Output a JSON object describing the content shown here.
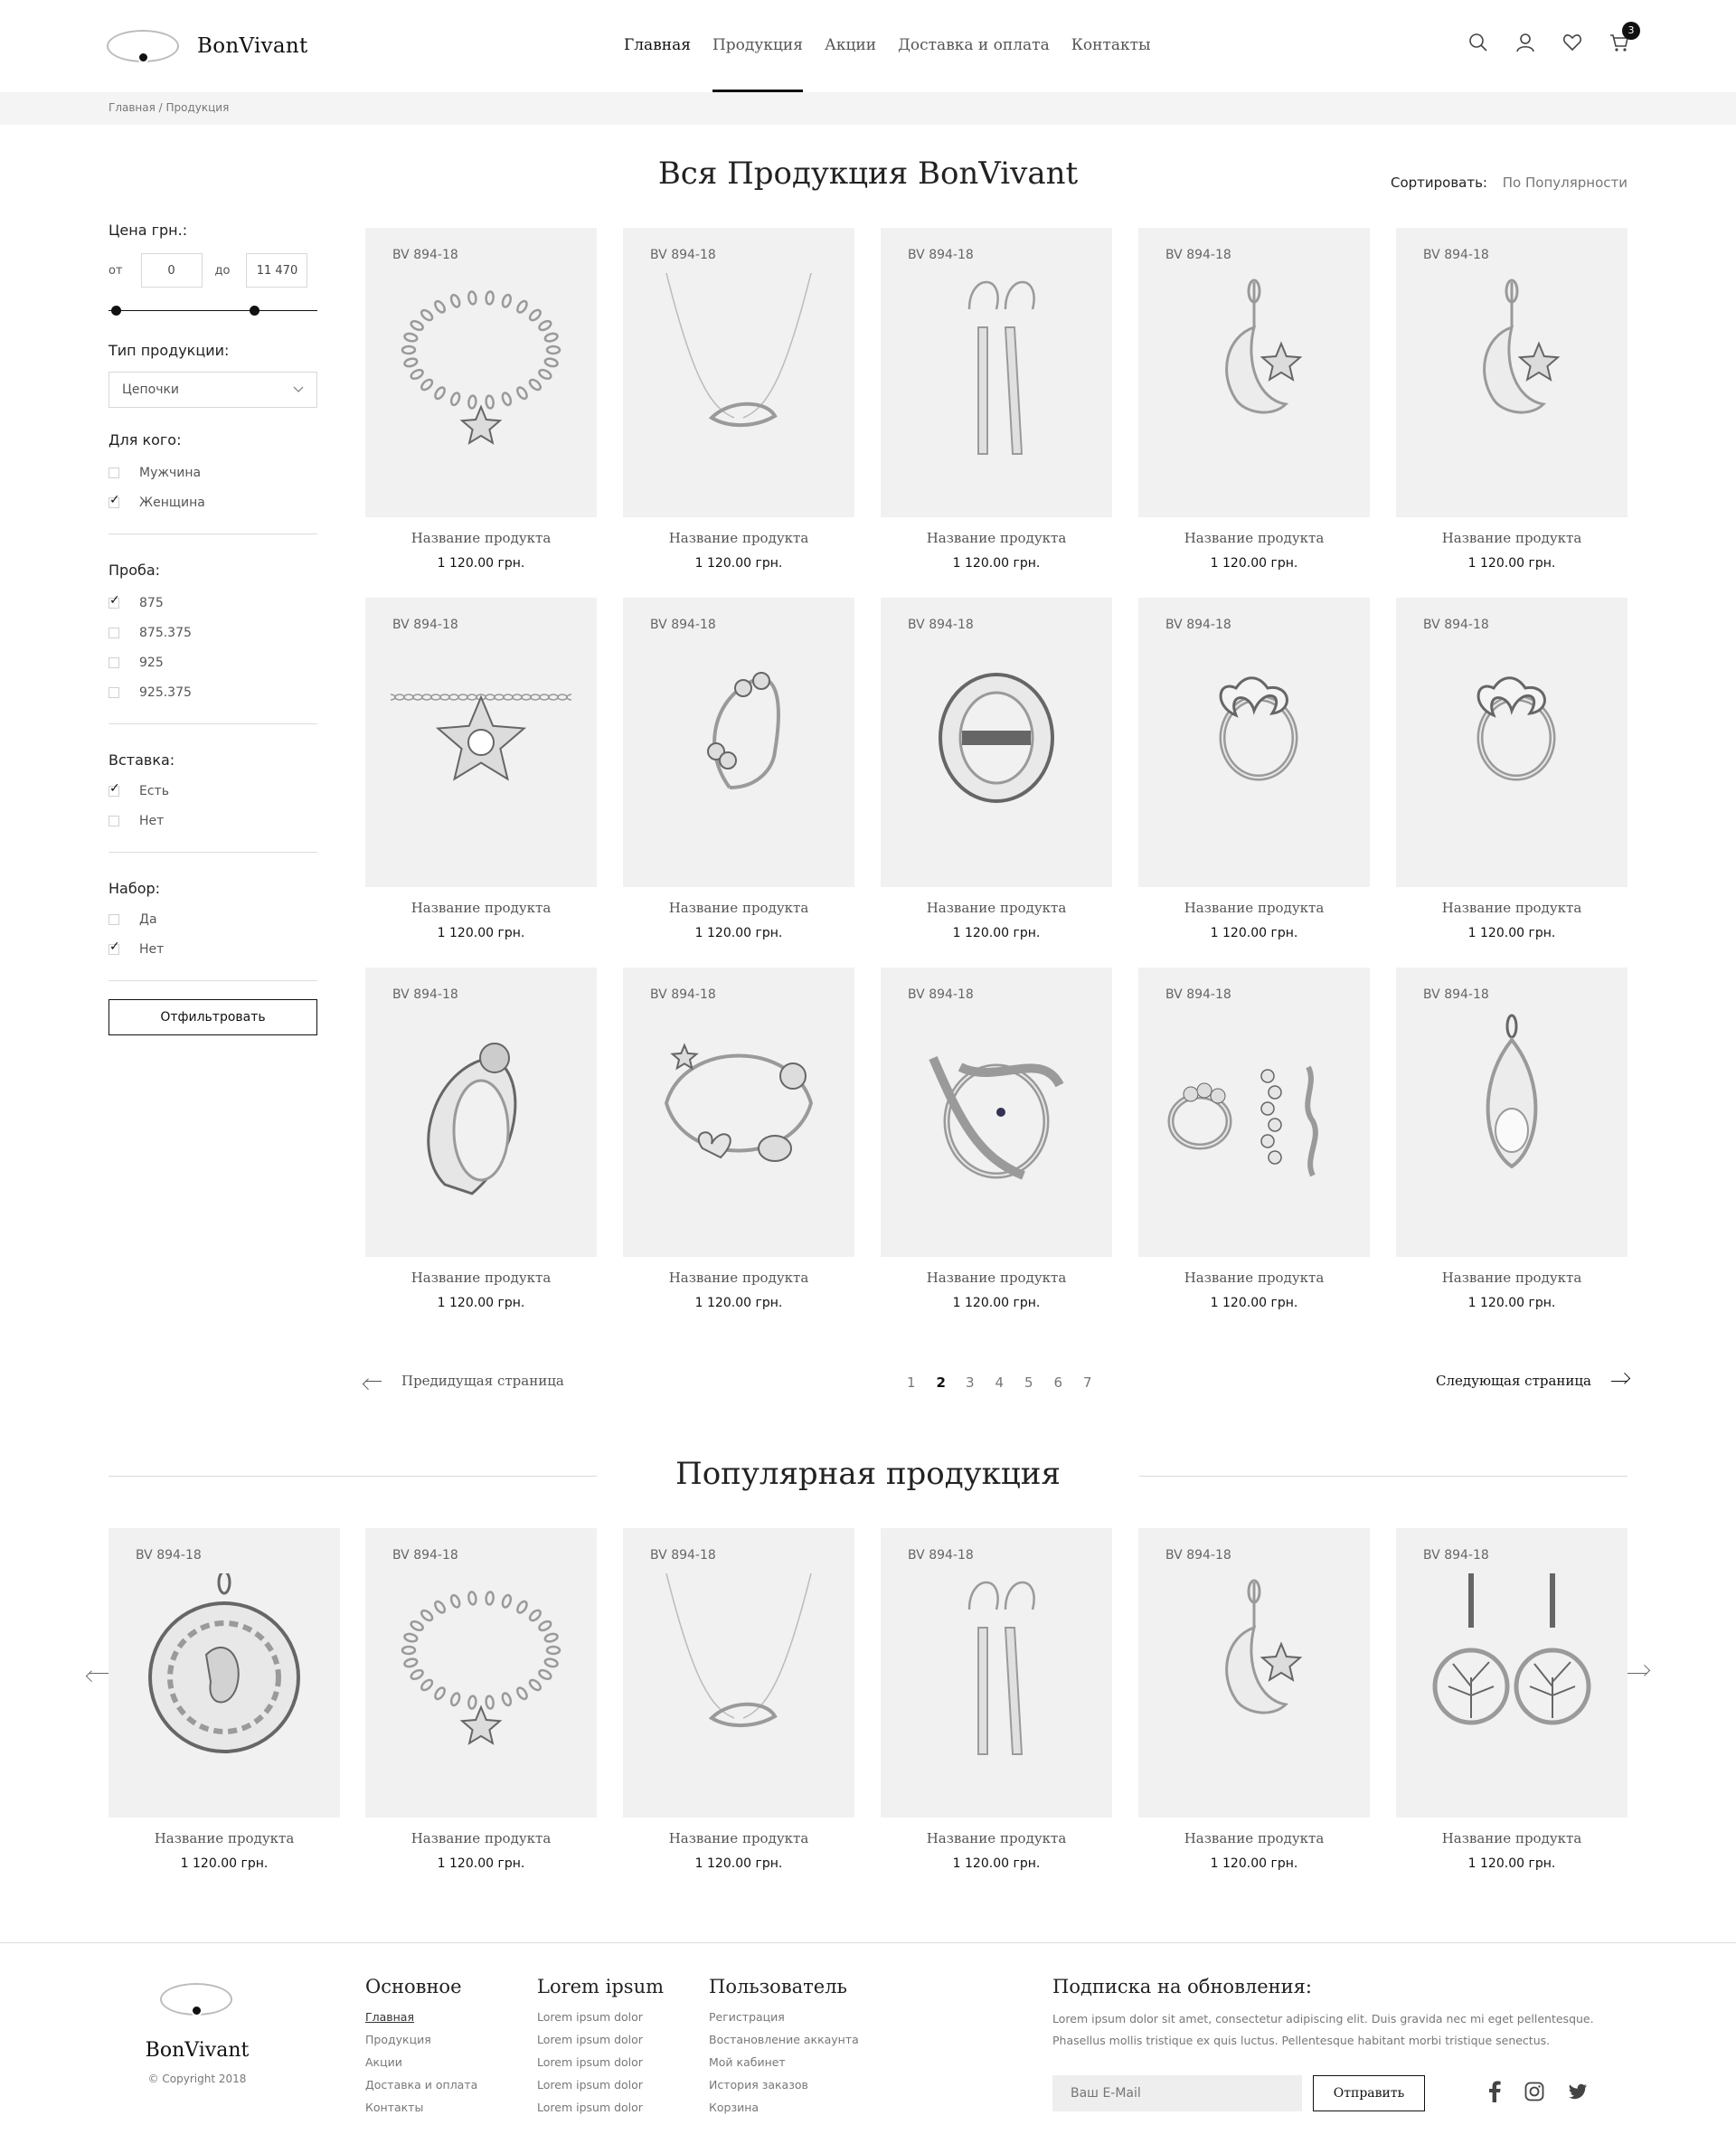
{
  "header": {
    "brand": "BonVivant",
    "nav": [
      "Главная",
      "Продукция",
      "Акции",
      "Доставка и оплата",
      "Контакты"
    ],
    "active_nav": "Продукция",
    "cart_count": "3",
    "icons": [
      "search-icon",
      "user-icon",
      "heart-icon",
      "cart-icon"
    ]
  },
  "breadcrumb": "Главная / Продукция",
  "page_title": "Вся Продукция BonVivant",
  "sort": {
    "label": "Сортировать:",
    "value": "По Популярности"
  },
  "filters": {
    "price": {
      "title": "Цена грн.:",
      "from_label": "от",
      "from_value": "0",
      "to_label": "до",
      "to_value": "11 470"
    },
    "type": {
      "title": "Тип продукции:",
      "selected": "Цепочки"
    },
    "for_whom": {
      "title": "Для кого:",
      "options": [
        {
          "label": "Мужчина",
          "checked": false
        },
        {
          "label": "Женщина",
          "checked": true
        }
      ]
    },
    "proba": {
      "title": "Проба:",
      "options": [
        {
          "label": "875",
          "checked": true
        },
        {
          "label": "875.375",
          "checked": false
        },
        {
          "label": "925",
          "checked": false
        },
        {
          "label": "925.375",
          "checked": false
        }
      ]
    },
    "insert": {
      "title": "Вставка:",
      "options": [
        {
          "label": "Есть",
          "checked": true
        },
        {
          "label": "Нет",
          "checked": false
        }
      ]
    },
    "set": {
      "title": "Набор:",
      "options": [
        {
          "label": "Да",
          "checked": false
        },
        {
          "label": "Нет",
          "checked": true
        }
      ]
    },
    "button": "Отфильтровать"
  },
  "products": [
    {
      "sku": "BV 894-18",
      "name": "Название продукта",
      "price": "1 120.00 грн.",
      "kind": "bracelet"
    },
    {
      "sku": "BV 894-18",
      "name": "Название продукта",
      "price": "1 120.00 грн.",
      "kind": "necklace"
    },
    {
      "sku": "BV 894-18",
      "name": "Название продукта",
      "price": "1 120.00 грн.",
      "kind": "earrings"
    },
    {
      "sku": "BV 894-18",
      "name": "Название продукта",
      "price": "1 120.00 грн.",
      "kind": "moon-pendant"
    },
    {
      "sku": "BV 894-18",
      "name": "Название продукта",
      "price": "1 120.00 грн.",
      "kind": "moon-pendant"
    },
    {
      "sku": "BV 894-18",
      "name": "Название продукта",
      "price": "1 120.00 грн.",
      "kind": "star-chain"
    },
    {
      "sku": "BV 894-18",
      "name": "Название продукта",
      "price": "1 120.00 грн.",
      "kind": "cuff"
    },
    {
      "sku": "BV 894-18",
      "name": "Название продукта",
      "price": "1 120.00 грн.",
      "kind": "round-ring"
    },
    {
      "sku": "BV 894-18",
      "name": "Название продукта",
      "price": "1 120.00 грн.",
      "kind": "butterfly-ring"
    },
    {
      "sku": "BV 894-18",
      "name": "Название продукта",
      "price": "1 120.00 грн.",
      "kind": "butterfly-ring"
    },
    {
      "sku": "BV 894-18",
      "name": "Название продукта",
      "price": "1 120.00 грн.",
      "kind": "ring"
    },
    {
      "sku": "BV 894-18",
      "name": "Название продукта",
      "price": "1 120.00 грн.",
      "kind": "charm-bracelet"
    },
    {
      "sku": "BV 894-18",
      "name": "Название продукта",
      "price": "1 120.00 грн.",
      "kind": "snake-ring"
    },
    {
      "sku": "BV 894-18",
      "name": "Название продукта",
      "price": "1 120.00 грн.",
      "kind": "set"
    },
    {
      "sku": "BV 894-18",
      "name": "Название продукта",
      "price": "1 120.00 грн.",
      "kind": "drop-pendant"
    }
  ],
  "pagination": {
    "prev": "Предидущая страница",
    "next": "Следующая страница",
    "pages": [
      "1",
      "2",
      "3",
      "4",
      "5",
      "6",
      "7"
    ],
    "current": "2"
  },
  "popular": {
    "title": "Популярная продукция",
    "items": [
      {
        "sku": "BV 894-18",
        "name": "Название продукта",
        "price": "1 120.00 грн.",
        "kind": "medallion"
      },
      {
        "sku": "BV 894-18",
        "name": "Название продукта",
        "price": "1 120.00 грн.",
        "kind": "bracelet"
      },
      {
        "sku": "BV 894-18",
        "name": "Название продукта",
        "price": "1 120.00 грн.",
        "kind": "necklace"
      },
      {
        "sku": "BV 894-18",
        "name": "Название продукта",
        "price": "1 120.00 грн.",
        "kind": "earrings"
      },
      {
        "sku": "BV 894-18",
        "name": "Название продукта",
        "price": "1 120.00 грн.",
        "kind": "moon-pendant"
      },
      {
        "sku": "BV 894-18",
        "name": "Название продукта",
        "price": "1 120.00 грн.",
        "kind": "tree-earrings"
      }
    ]
  },
  "footer": {
    "brand": "BonVivant",
    "copyright": "© Copyright 2018",
    "columns": [
      {
        "title": "Основное",
        "links": [
          "Главная",
          "Продукция",
          "Акции",
          "Доставка и оплата",
          "Контакты"
        ]
      },
      {
        "title": "Lorem ipsum",
        "links": [
          "Lorem ipsum dolor",
          "Lorem ipsum dolor",
          "Lorem ipsum dolor",
          "Lorem ipsum dolor",
          "Lorem ipsum dolor"
        ]
      },
      {
        "title": "Пользователь",
        "links": [
          "Регистрация",
          "Востановление аккаунта",
          "Мой кабинет",
          "История заказов",
          "Корзина"
        ]
      }
    ],
    "subscribe": {
      "title": "Подписка на обновления:",
      "text_1": "Lorem ipsum dolor sit amet, consectetur adipiscing elit. Duis gravida nec mi eget pellentesque.",
      "text_2": "Phasellus mollis tristique ex quis luctus. Pellentesque habitant morbi tristique senectus.",
      "placeholder": "Ваш E-Mail",
      "button": "Отправить"
    },
    "social": [
      "facebook-icon",
      "instagram-icon",
      "twitter-icon"
    ]
  }
}
